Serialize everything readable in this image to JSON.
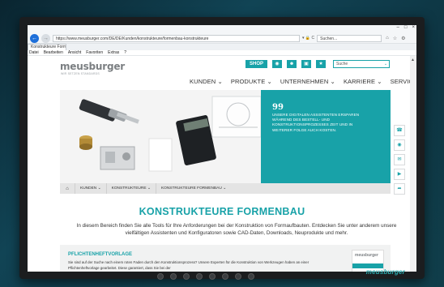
{
  "browser": {
    "url": "https://www.meusburger.com/DE/DE/Kunden/konstrukteure/formenbau-konstrukteure",
    "url_icons": "▾ 🔒 C",
    "search_placeholder": "Suchen...",
    "tab_title": "Konstrukteure Formenbau",
    "menu": [
      "Datei",
      "Bearbeiten",
      "Ansicht",
      "Favoriten",
      "Extras",
      "?"
    ],
    "window_controls": [
      "–",
      "□",
      "×"
    ]
  },
  "header": {
    "logo": "meusburger",
    "tagline": "WIR SETZEN STANDARDS",
    "shop": "SHOP",
    "search_placeholder": "Suche"
  },
  "nav": {
    "items": [
      "KUNDEN",
      "PRODUKTE",
      "UNTERNEHMEN",
      "KARRIERE",
      "SERVICE"
    ]
  },
  "hero": {
    "quote_mark": "99",
    "quote": "UNSERE DIGITALEN ASSISTENTEN ERSPAREN WÄHREND DES BESTELL- UND KONSTRUKTIONSPROZESSES ZEIT UND IN WEITERER FOLGE AUCH KOSTEN."
  },
  "breadcrumb": [
    "KUNDEN",
    "KONSTRUKTEURE",
    "KONSTRUKTEURE FORMENBAU"
  ],
  "page": {
    "title": "KONSTRUKTEURE FORMENBAU",
    "intro": "In diesem Bereich finden Sie alle Tools für Ihre Anforderungen bei der Konstruktion von Formaufbauten. Entdecken Sie unter anderem unsere vielfältigen Assistenten und Konfiguratoren sowie CAD-Daten, Downloads, Neuprodukte und mehr."
  },
  "card": {
    "title": "PFLICHTENHEFTVORLAGE",
    "text": "Sie sind auf der Suche nach einem roten Faden durch den Konstruktionsprozess? Unsere Experten für die Konstruktion von Werkzeugen haben an einer Pflichtenheftvorlage gearbeitet. Diese garantiert, dass Sie bei der",
    "thumb_logo": "meusburger"
  },
  "monitor": {
    "brand": "meusburger"
  },
  "colors": {
    "accent": "#18a2a8",
    "logo_gray": "#7b7f82"
  }
}
